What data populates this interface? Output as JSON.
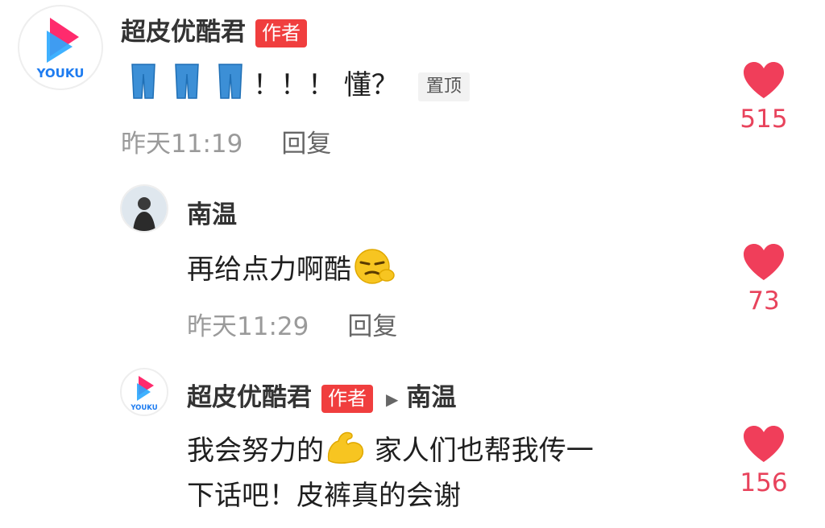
{
  "colors": {
    "like_red": "#f03e5a",
    "badge_red": "#f03e3e",
    "count_red": "#e8435c",
    "meta_gray": "#9a9a9a"
  },
  "comments": [
    {
      "username": "超皮优酷君",
      "badge": "作者",
      "avatar_logo_text": "YOUKU",
      "text": "！！！ 懂？",
      "emoji": "jeans-emoji",
      "pinned_label": "置顶",
      "time": "昨天11:19",
      "reply_label": "回复",
      "likes": "515"
    },
    {
      "username": "南温",
      "text": "再给点力啊酷",
      "emoji": "smirking-face-emoji",
      "time": "昨天11:29",
      "reply_label": "回复",
      "likes": "73"
    },
    {
      "username": "超皮优酷君",
      "badge": "作者",
      "avatar_logo_text": "YOUKU",
      "reply_to": "南温",
      "text_line1_a": "我会努力的",
      "emoji": "flexed-biceps-emoji",
      "text_line1_b": " 家人们也帮我传一",
      "text_line2": "下话吧！皮裤真的会谢",
      "likes": "156"
    }
  ]
}
